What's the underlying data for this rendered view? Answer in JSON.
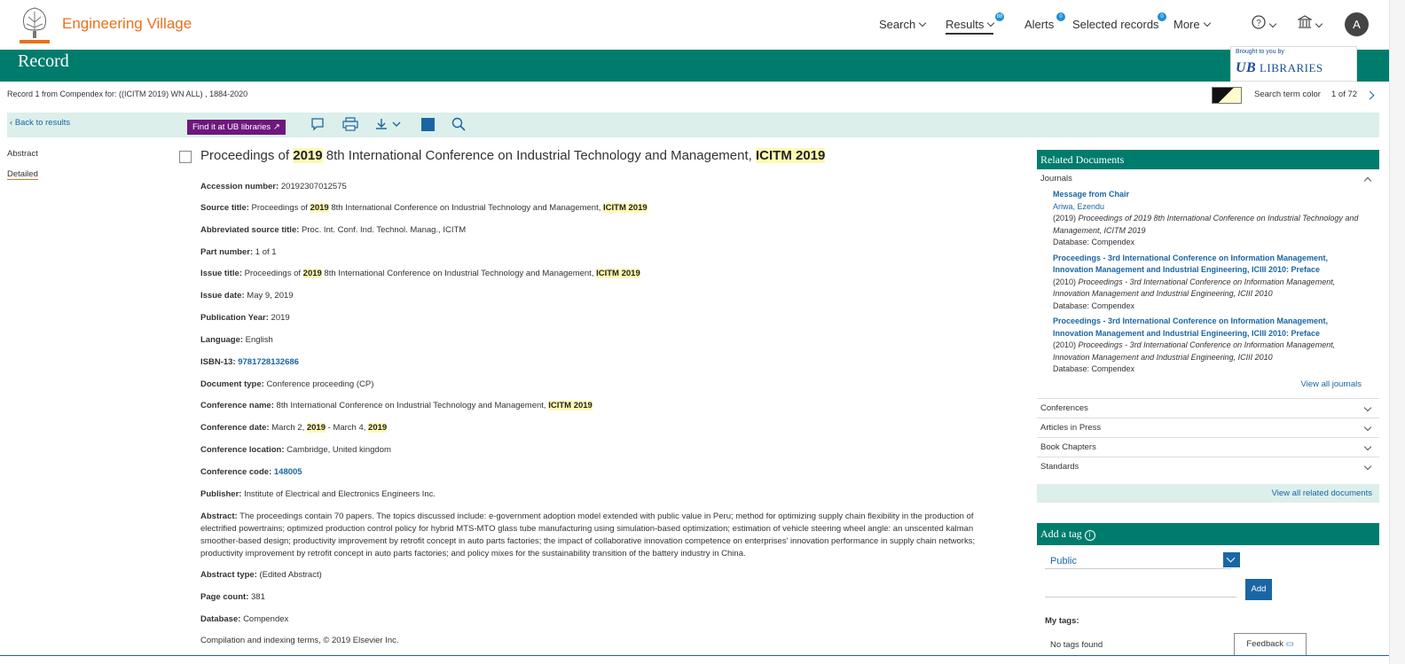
{
  "brand": "Engineering Village",
  "nav": {
    "search": "Search",
    "results": "Results",
    "results_badge": "88",
    "alerts": "Alerts",
    "alerts_badge": "0",
    "selected": "Selected records",
    "selected_badge": "0",
    "more": "More",
    "avatar": "A"
  },
  "banner": {
    "title": "Record",
    "brought": "Brought to you by",
    "libraries": "LIBRARIES",
    "ub": "UB"
  },
  "recinfo": "Record 1 from Compendex for: ((ICITM 2019) WN ALL) , 1884-2020",
  "search_term_color": "Search term color",
  "pager": "1 of 72",
  "toolbar": {
    "back": "Back to results",
    "findit": "Find it at UB libraries"
  },
  "sidenav": {
    "abstract": "Abstract",
    "detailed": "Detailed"
  },
  "title": {
    "p1": "Proceedings of ",
    "h1": "2019",
    "p2": " 8th International Conference on Industrial Technology and Management, ",
    "h2": "ICITM 2019"
  },
  "fields": {
    "accession_l": "Accession number:",
    "accession_v": "20192307012575",
    "source_l": "Source title:",
    "source_p1": "Proceedings of ",
    "source_h1": "2019",
    "source_p2": " 8th International Conference on Industrial Technology and Management, ",
    "source_h2": "ICITM 2019",
    "abbr_l": "Abbreviated source title:",
    "abbr_v": "Proc. Int. Conf. Ind. Technol. Manag., ICITM",
    "part_l": "Part number:",
    "part_v": "1 of 1",
    "issue_l": "Issue title:",
    "issue_p1": "Proceedings of ",
    "issue_h1": "2019",
    "issue_p2": " 8th International Conference on Industrial Technology and Management, ",
    "issue_h2": "ICITM 2019",
    "idate_l": "Issue date:",
    "idate_v": "May 9, 2019",
    "pyear_l": "Publication Year:",
    "pyear_v": "2019",
    "lang_l": "Language:",
    "lang_v": "English",
    "isbn_l": "ISBN-13:",
    "isbn_v": "9781728132686",
    "dtype_l": "Document type:",
    "dtype_v": "Conference proceeding (CP)",
    "cname_l": "Conference name:",
    "cname_p1": "8th International Conference on Industrial Technology and Management, ",
    "cname_h1": "ICITM 2019",
    "cdate_l": "Conference date:",
    "cdate_p1": "March 2, ",
    "cdate_h1": "2019",
    "cdate_p2": " - March 4, ",
    "cdate_h2": "2019",
    "cloc_l": "Conference location:",
    "cloc_v": "Cambridge, United kingdom",
    "ccode_l": "Conference code:",
    "ccode_v": "148005",
    "pub_l": "Publisher:",
    "pub_v": "Institute of Electrical and Electronics Engineers Inc.",
    "abs_l": "Abstract:",
    "abs_v": "The proceedings contain 70 papers. The topics discussed include: e-government adoption model extended with public value in Peru; method for optimizing supply chain flexibility in the production of electrified powertrains; optimized production control policy for hybrid MTS-MTO glass tube manufacturing using simulation-based optimization; estimation of vehicle steering wheel angle: an unscented kalman smoother-based design; productivity improvement by retrofit concept in auto parts factories; the impact of collaborative innovation competence on enterprises' innovation performance in supply chain networks; productivity improvement by retrofit concept in auto parts factories; and policy mixes for the sustainability transition of the battery industry in China.",
    "abstype_l": "Abstract type:",
    "abstype_v": "(Edited Abstract)",
    "pcount_l": "Page count:",
    "pcount_v": "381",
    "db_l": "Database:",
    "db_v": "Compendex",
    "comp": "Compilation and indexing terms, © 2019 Elsevier Inc."
  },
  "related": {
    "header": "Related Documents",
    "journals": "Journals",
    "items": [
      {
        "title": "Message from Chair",
        "author": "Ariwa, Ezendu",
        "year": "(2019)",
        "src": "Proceedings of 2019 8th International Conference on Industrial Technology and Management, ICITM 2019",
        "db": "Database: Compendex"
      },
      {
        "title": "Proceedings - 3rd International Conference on Information Management, Innovation Management and Industrial Engineering, ICIII 2010: Preface",
        "year": "(2010)",
        "src": "Proceedings - 3rd International Conference on Information Management, Innovation Management and Industrial Engineering, ICIII 2010",
        "db": "Database: Compendex"
      },
      {
        "title": "Proceedings - 3rd International Conference on Information Management, Innovation Management and Industrial Engineering, ICIII 2010: Preface",
        "year": "(2010)",
        "src": "Proceedings - 3rd International Conference on Information Management, Innovation Management and Industrial Engineering, ICIII 2010",
        "db": "Database: Compendex"
      }
    ],
    "view_all_journals": "View all journals",
    "conferences": "Conferences",
    "articles": "Articles in Press",
    "books": "Book Chapters",
    "standards": "Standards",
    "view_all": "View all related documents"
  },
  "tag": {
    "header": "Add a tag",
    "visibility": "Public",
    "add": "Add",
    "mytags": "My tags:",
    "none": "No tags found"
  },
  "feedback": "Feedback",
  "colors": {
    "teal": "#007c6d",
    "orange": "#e9711c",
    "purple": "#6e177d",
    "link": "#1a66a3",
    "highlight": "#fffab4"
  }
}
